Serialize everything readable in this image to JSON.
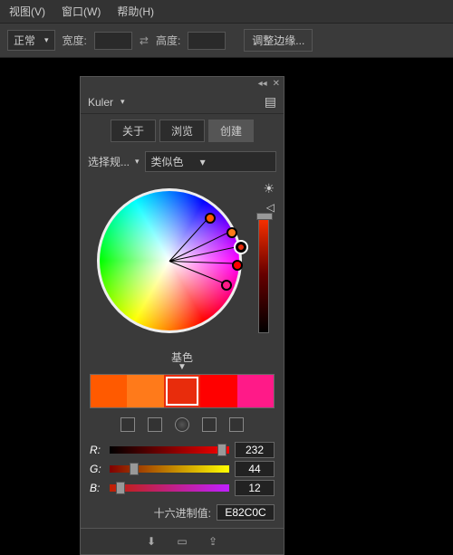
{
  "menubar": {
    "view": "视图(V)",
    "window": "窗口(W)",
    "help": "帮助(H)"
  },
  "toolbar": {
    "mode": "正常",
    "width_label": "宽度:",
    "height_label": "高度:",
    "adjust_edges": "调整边缘..."
  },
  "panel": {
    "title": "Kuler",
    "tabs": {
      "about": "关于",
      "browse": "浏览",
      "create": "创建"
    },
    "rule_label": "选择规...",
    "rule_value": "类似色",
    "base_label": "基色",
    "swatches": [
      "#FF5A00",
      "#FF7A1A",
      "#E82C0C",
      "#FF0000",
      "#FF1A88"
    ],
    "selected_index": 2,
    "rgb": {
      "r": {
        "label": "R:",
        "value": "232"
      },
      "g": {
        "label": "G:",
        "value": "44"
      },
      "b": {
        "label": "B:",
        "value": "12"
      }
    },
    "hex_label": "十六进制值:",
    "hex_value": "E82C0C"
  }
}
